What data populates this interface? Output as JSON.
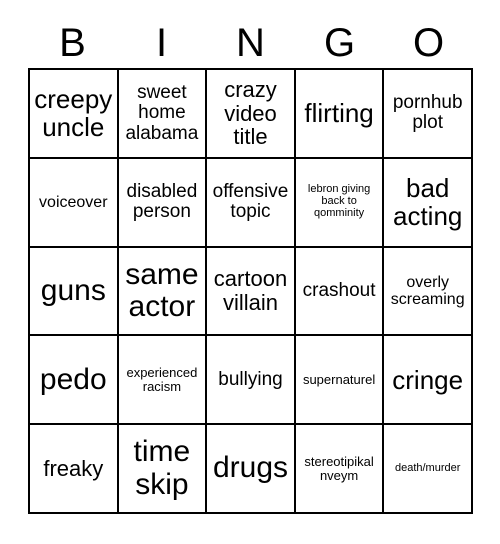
{
  "card": {
    "headers": [
      "B",
      "I",
      "N",
      "G",
      "O"
    ],
    "rows": [
      [
        {
          "text": "creepy uncle",
          "size": "xl"
        },
        {
          "text": "sweet home alabama",
          "size": "m"
        },
        {
          "text": "crazy video title",
          "size": "l"
        },
        {
          "text": "flirting",
          "size": "xl"
        },
        {
          "text": "pornhub plot",
          "size": "m"
        }
      ],
      [
        {
          "text": "voiceover",
          "size": "s"
        },
        {
          "text": "disabled person",
          "size": "m"
        },
        {
          "text": "offensive topic",
          "size": "m"
        },
        {
          "text": "lebron giving back to qomminity",
          "size": "xxs"
        },
        {
          "text": "bad acting",
          "size": "xl"
        }
      ],
      [
        {
          "text": "guns",
          "size": "xxl"
        },
        {
          "text": "same actor",
          "size": "xxl"
        },
        {
          "text": "cartoon villain",
          "size": "l"
        },
        {
          "text": "crashout",
          "size": "m"
        },
        {
          "text": "overly screaming",
          "size": "s"
        }
      ],
      [
        {
          "text": "pedo",
          "size": "xxl"
        },
        {
          "text": "experienced racism",
          "size": "xs"
        },
        {
          "text": "bullying",
          "size": "m"
        },
        {
          "text": "supernaturel",
          "size": "xs"
        },
        {
          "text": "cringe",
          "size": "xl"
        }
      ],
      [
        {
          "text": "freaky",
          "size": "l"
        },
        {
          "text": "time skip",
          "size": "xxl"
        },
        {
          "text": "drugs",
          "size": "xxl"
        },
        {
          "text": "stereotipikal nveym",
          "size": "xs"
        },
        {
          "text": "death/murder",
          "size": "xxs"
        }
      ]
    ]
  },
  "colors": {
    "border": "#000000",
    "text": "#000000",
    "background": "#ffffff"
  }
}
